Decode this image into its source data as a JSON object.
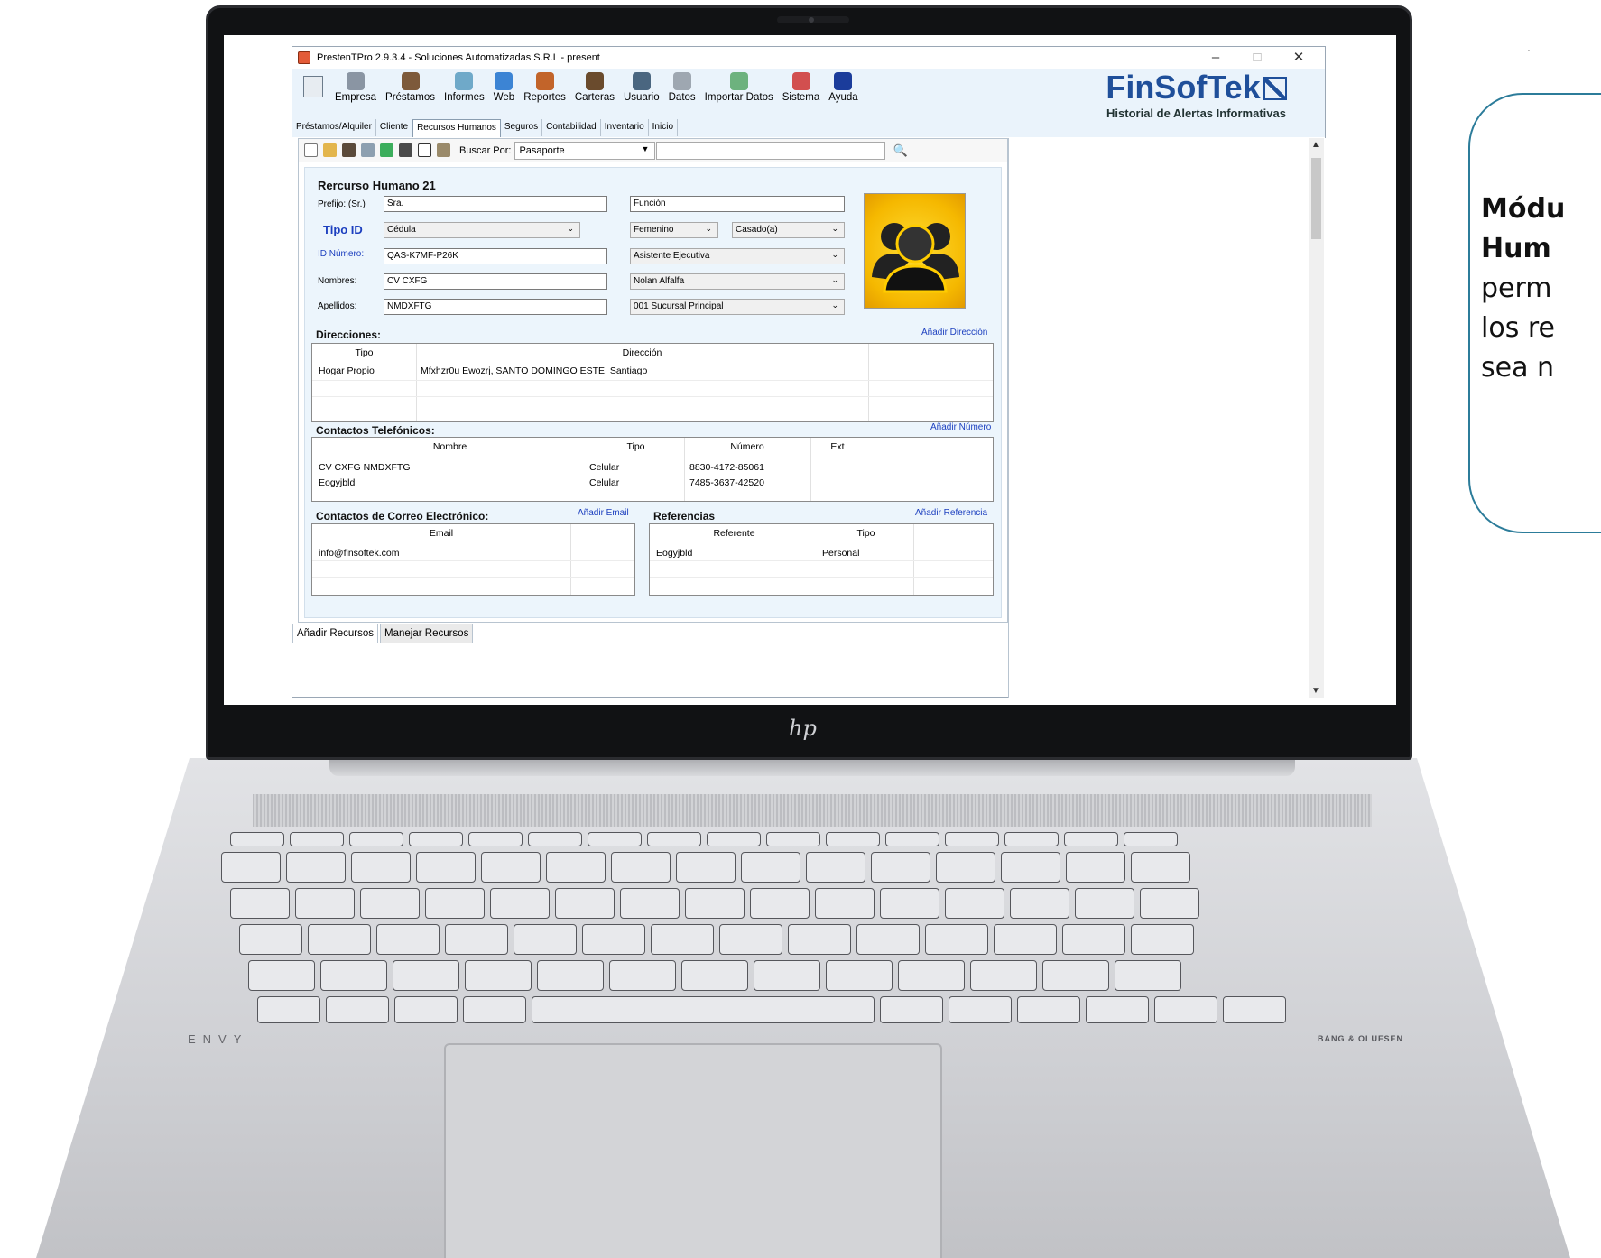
{
  "window": {
    "title": "PrestenTPro 2.9.3.4 - Soluciones Automatizadas S.R.L - present",
    "minimize": "–",
    "maximize": "□",
    "close": "✕"
  },
  "ribbon": {
    "items": [
      {
        "label": "Empresa",
        "icon": "building-icon",
        "color": "#8a95a3"
      },
      {
        "label": "Préstamos",
        "icon": "handshake-icon",
        "color": "#7d5a3b"
      },
      {
        "label": "Informes",
        "icon": "chart-icon",
        "color": "#6fa9c9"
      },
      {
        "label": "Web",
        "icon": "globe-icon",
        "color": "#3c84d4"
      },
      {
        "label": "Reportes",
        "icon": "reports-icon",
        "color": "#c2642a"
      },
      {
        "label": "Carteras",
        "icon": "portfolio-icon",
        "color": "#6a4b2d"
      },
      {
        "label": "Usuario",
        "icon": "user-icon",
        "color": "#4a6680"
      },
      {
        "label": "Datos",
        "icon": "data-icon",
        "color": "#9ea7b1"
      },
      {
        "label": "Importar Datos",
        "icon": "import-icon",
        "color": "#6db27e"
      },
      {
        "label": "Sistema",
        "icon": "system-icon",
        "color": "#d24f4f"
      },
      {
        "label": "Ayuda",
        "icon": "help-icon",
        "color": "#1b3c9b"
      }
    ]
  },
  "brand": {
    "logo": "FinSofTek",
    "subtitle": "Historial de Alertas Informativas"
  },
  "tabs": [
    "Préstamos/Alquiler",
    "Cliente",
    "Recursos Humanos",
    "Seguros",
    "Contabilidad",
    "Inventario",
    "Inicio"
  ],
  "toolbar": {
    "search_by_label": "Buscar Por:",
    "search_by_value": "Pasaporte"
  },
  "form": {
    "record_title": "Rercurso Humano 21",
    "prefix_label": "Prefijo: (Sr.)",
    "prefix_value": "Sra.",
    "id_type_label": "Tipo ID",
    "id_type_value": "Cédula",
    "id_number_label": "ID Número:",
    "id_number_value": "QAS-K7MF-P26K",
    "names_label": "Nombres:",
    "names_value": "CV CXFG",
    "surnames_label": "Apellidos:",
    "surnames_value": "NMDXFTG",
    "function_value": "Función",
    "gender_value": "Femenino",
    "marital_value": "Casado(a)",
    "position_value": "Asistente Ejecutiva",
    "manager_value": "Nolan Alfalfa",
    "branch_value": "001 Sucursal Principal"
  },
  "addresses": {
    "title": "Direcciones:",
    "add_link": "Añadir Dirección",
    "headers": [
      "Tipo",
      "Dirección"
    ],
    "rows": [
      [
        "Hogar Propio",
        "Mfxhzr0u Ewozrj, SANTO DOMINGO ESTE, Santiago"
      ]
    ]
  },
  "phones": {
    "title": "Contactos Telefónicos:",
    "add_link": "Añadir Número",
    "headers": [
      "Nombre",
      "Tipo",
      "Número",
      "Ext"
    ],
    "rows": [
      [
        "CV CXFG NMDXFTG",
        "Celular",
        "8830-4172-85061",
        ""
      ],
      [
        "Eogyjbld",
        "Celular",
        "7485-3637-42520",
        ""
      ]
    ]
  },
  "emails": {
    "title": "Contactos de Correo Electrónico:",
    "add_link": "Añadir Email",
    "headers": [
      "Email"
    ],
    "rows": [
      [
        "info@finsoftek.com"
      ]
    ]
  },
  "references": {
    "title": "Referencias",
    "add_link": "Añadir Referencia",
    "headers": [
      "Referente",
      "Tipo"
    ],
    "rows": [
      [
        "Eogyjbld",
        "Personal"
      ]
    ]
  },
  "bottom_tabs": [
    "Añadir Recursos",
    "Manejar Recursos"
  ],
  "laptop": {
    "brand": "hp",
    "model": "ENVY",
    "audio": "BANG & OLUFSEN"
  },
  "callout": {
    "line1": "Módu",
    "line2": "Hum",
    "line3": "perm",
    "line4": "los re",
    "line5": "sea n"
  },
  "corner_dot": "."
}
